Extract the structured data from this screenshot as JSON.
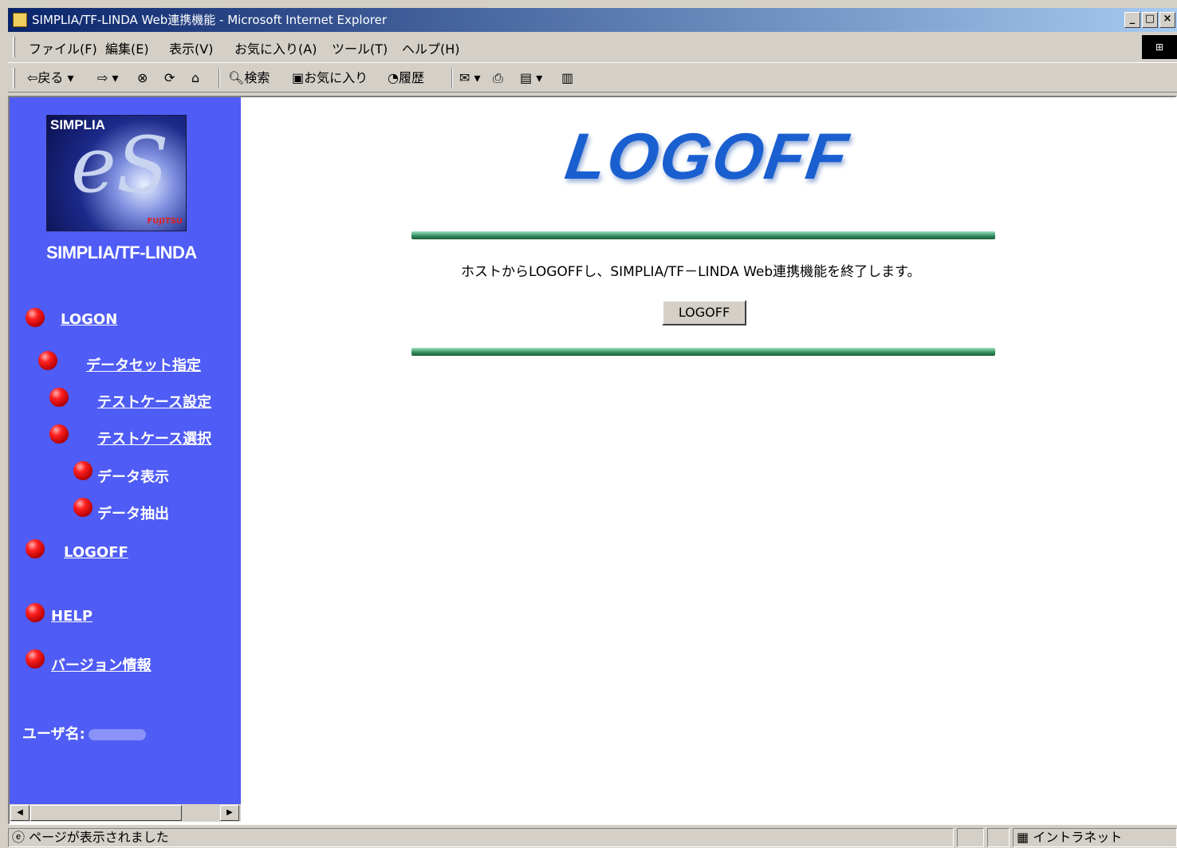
{
  "window": {
    "title": "SIMPLIA/TF-LINDA Web連携機能 - Microsoft Internet Explorer",
    "minimize": "_",
    "maximize": "□",
    "close": "×"
  },
  "menu": [
    "ファイル(F)",
    "編集(E)",
    "表示(V)",
    "お気に入り(A)",
    "ツール(T)",
    "ヘルプ(H)"
  ],
  "toolbar": {
    "back": "戻る",
    "search": "検索",
    "favorites": "お気に入り",
    "history": "履歴"
  },
  "sidebar": {
    "logo_title": "SIMPLIA",
    "logo_brand": "FUJITSU",
    "product_name": "SIMPLIA/TF-LINDA",
    "nav": {
      "logon": "LOGON",
      "dataset": "データセット指定",
      "testcase_setting": "テストケース設定",
      "testcase_select": "テストケース選択",
      "data_display": "データ表示",
      "data_extract": "データ抽出",
      "logoff": "LOGOFF",
      "help": "HELP",
      "version": "バージョン情報"
    },
    "username_label": "ユーザ名:"
  },
  "main": {
    "banner": "LOGOFF",
    "message": "ホストからLOGOFFし、SIMPLIA/TF－LINDA Web連携機能を終了します。",
    "logoff_button": "LOGOFF"
  },
  "status": {
    "text": "ページが表示されました",
    "zone": "イントラネット"
  }
}
